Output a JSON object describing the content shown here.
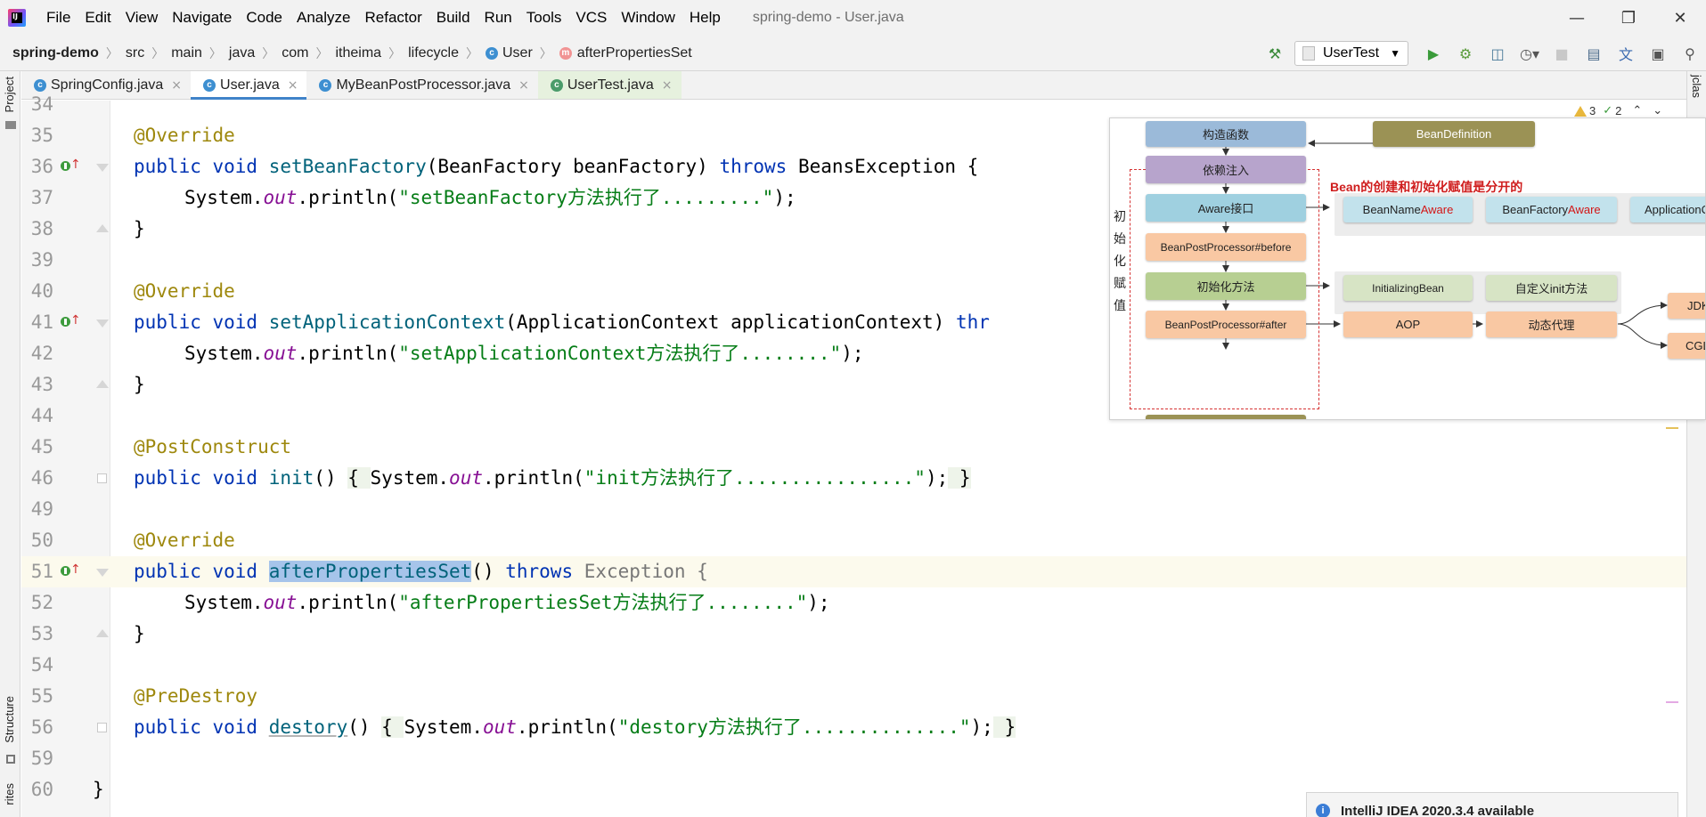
{
  "menu": [
    "File",
    "Edit",
    "View",
    "Navigate",
    "Code",
    "Analyze",
    "Refactor",
    "Build",
    "Run",
    "Tools",
    "VCS",
    "Window",
    "Help"
  ],
  "window_title": "spring-demo - User.java",
  "breadcrumbs": [
    "spring-demo",
    "src",
    "main",
    "java",
    "com",
    "itheima",
    "lifecycle",
    "User",
    "afterPropertiesSet"
  ],
  "run_config": "UserTest",
  "side_labels": {
    "project": "Project",
    "structure": "Structure",
    "favorites": "rites",
    "jclass": "jclas"
  },
  "tabs": [
    {
      "label": "SpringConfig.java"
    },
    {
      "label": "User.java"
    },
    {
      "label": "MyBeanPostProcessor.java"
    },
    {
      "label": "UserTest.java"
    }
  ],
  "inspections": {
    "warnings": "3",
    "ok": "2"
  },
  "code_lines": [
    {
      "n": "34"
    },
    {
      "n": "35"
    },
    {
      "n": "36"
    },
    {
      "n": "37"
    },
    {
      "n": "38"
    },
    {
      "n": "39"
    },
    {
      "n": "40"
    },
    {
      "n": "41"
    },
    {
      "n": "42"
    },
    {
      "n": "43"
    },
    {
      "n": "44"
    },
    {
      "n": "45"
    },
    {
      "n": "46"
    },
    {
      "n": "49"
    },
    {
      "n": "50"
    },
    {
      "n": "51"
    },
    {
      "n": "52"
    },
    {
      "n": "53"
    },
    {
      "n": "54"
    },
    {
      "n": "55"
    },
    {
      "n": "56"
    },
    {
      "n": "59"
    },
    {
      "n": "60"
    }
  ],
  "code": {
    "override": "@Override",
    "postconstruct": "@PostConstruct",
    "predestroy": "@PreDestroy",
    "public_void": "public void ",
    "throws": "throws",
    "sysout": "System.",
    "out": "out",
    "println": ".println(",
    "end": ");",
    "m1_name": "setBeanFactory",
    "m1_params": "(BeanFactory beanFactory) ",
    "m1_exc": " BeansException {",
    "m1_str": "\"setBeanFactory方法执行了.........\"",
    "m2_name": "setApplicationContext",
    "m2_params": "(ApplicationContext applicationContext) ",
    "m2_thr": "thr",
    "m2_str": "\"setApplicationContext方法执行了........\"",
    "m3_name": "init",
    "m3_str": "\"init方法执行了................\"",
    "m4_name": "afterPropertiesSet",
    "m4_tail": "() ",
    "m4_exc": " Exception {",
    "m4_str": "\"afterPropertiesSet方法执行了........\"",
    "m5_name": "destory",
    "m5_str": "\"destory方法执行了..............\"",
    "close_brace": "}",
    "open_brace": "{ ",
    "empty_parens": "() ",
    "close_brace_inline": " }"
  },
  "diagram": {
    "constructor": "构造函数",
    "bean_definition": "BeanDefinition",
    "dependency_injection": "依赖注入",
    "note": "Bean的创建和初始化赋值是分开的",
    "aware_interface": "Aware接口",
    "bean_name_aware_a": "BeanName",
    "bean_name_aware_b": "Aware",
    "bean_factory_aware_a": "BeanFactory",
    "bean_factory_aware_b": "Aware",
    "application_context": "ApplicationC",
    "side_label": [
      "初",
      "始",
      "化",
      "赋",
      "值"
    ],
    "bpp_before": "BeanPostProcessor#before",
    "init_method": "初始化方法",
    "initializing_bean": "InitializingBean",
    "custom_init": "自定义init方法",
    "bpp_after": "BeanPostProcessor#after",
    "aop": "AOP",
    "dynamic_proxy": "动态代理",
    "jdk": "JDK",
    "cglib": "CGLI"
  },
  "notification": "IntelliJ IDEA 2020.3.4 available"
}
